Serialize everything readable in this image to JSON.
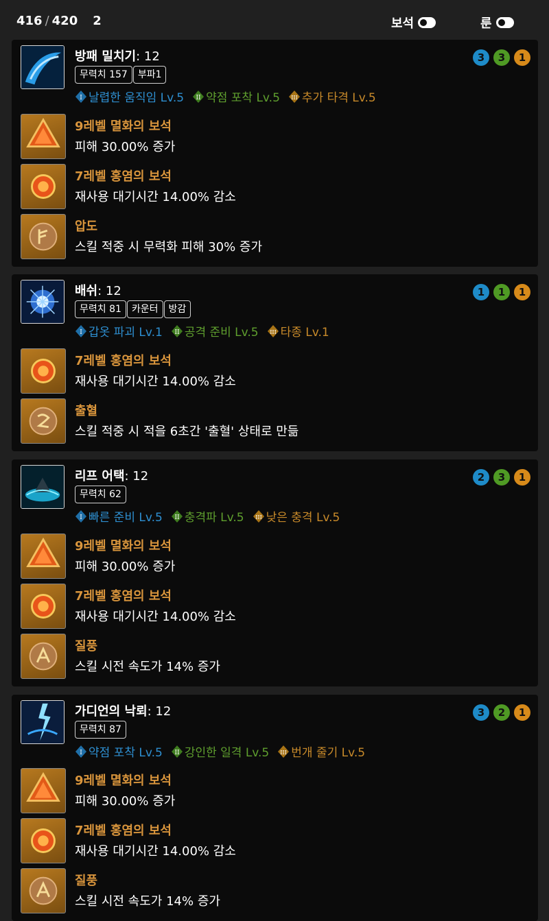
{
  "header": {
    "points_used": "416",
    "points_sep": "/",
    "points_total": "420",
    "extra": "2",
    "gem_toggle_label": "보석",
    "rune_toggle_label": "룬"
  },
  "skills": [
    {
      "name": "방패 밀치기",
      "level": ": 12",
      "tags": [
        "무력치 157",
        "부파1"
      ],
      "tripods": [
        {
          "label": "날렵한 움직임 Lv.5"
        },
        {
          "label": "약점 포착 Lv.5"
        },
        {
          "label": "추가 타격 Lv.5"
        }
      ],
      "levels": [
        "3",
        "3",
        "1"
      ],
      "items": [
        {
          "title": "9레벨 멸화의 보석",
          "desc": "피해 30.00% 증가"
        },
        {
          "title": "7레벨 홍염의 보석",
          "desc": "재사용 대기시간 14.00% 감소"
        },
        {
          "title": "압도",
          "desc": "스킬 적중 시 무력화 피해 30% 증가"
        }
      ]
    },
    {
      "name": "배쉬",
      "level": ": 12",
      "tags": [
        "무력치 81",
        "카운터",
        "방감"
      ],
      "tripods": [
        {
          "label": "갑옷 파괴 Lv.1"
        },
        {
          "label": "공격 준비 Lv.5"
        },
        {
          "label": "타종 Lv.1"
        }
      ],
      "levels": [
        "1",
        "1",
        "1"
      ],
      "items": [
        {
          "title": "7레벨 홍염의 보석",
          "desc": "재사용 대기시간 14.00% 감소"
        },
        {
          "title": "출혈",
          "desc": "스킬 적중 시 적을 6초간 '출혈' 상태로 만듦"
        }
      ]
    },
    {
      "name": "리프 어택",
      "level": ": 12",
      "tags": [
        "무력치 62"
      ],
      "tripods": [
        {
          "label": "빠른 준비 Lv.5"
        },
        {
          "label": "충격파 Lv.5"
        },
        {
          "label": "낮은 충격 Lv.5"
        }
      ],
      "levels": [
        "2",
        "3",
        "1"
      ],
      "items": [
        {
          "title": "9레벨 멸화의 보석",
          "desc": "피해 30.00% 증가"
        },
        {
          "title": "7레벨 홍염의 보석",
          "desc": "재사용 대기시간 14.00% 감소"
        },
        {
          "title": "질풍",
          "desc": "스킬 시전 속도가 14% 증가"
        }
      ]
    },
    {
      "name": "가디언의 낙뢰",
      "level": ": 12",
      "tags": [
        "무력치 87"
      ],
      "tripods": [
        {
          "label": "약점 포착 Lv.5"
        },
        {
          "label": "강인한 일격 Lv.5"
        },
        {
          "label": "번개 줄기 Lv.5"
        }
      ],
      "levels": [
        "3",
        "2",
        "1"
      ],
      "items": [
        {
          "title": "9레벨 멸화의 보석",
          "desc": "피해 30.00% 증가"
        },
        {
          "title": "7레벨 홍염의 보석",
          "desc": "재사용 대기시간 14.00% 감소"
        },
        {
          "title": "질풍",
          "desc": "스킬 시전 속도가 14% 증가"
        }
      ]
    }
  ]
}
